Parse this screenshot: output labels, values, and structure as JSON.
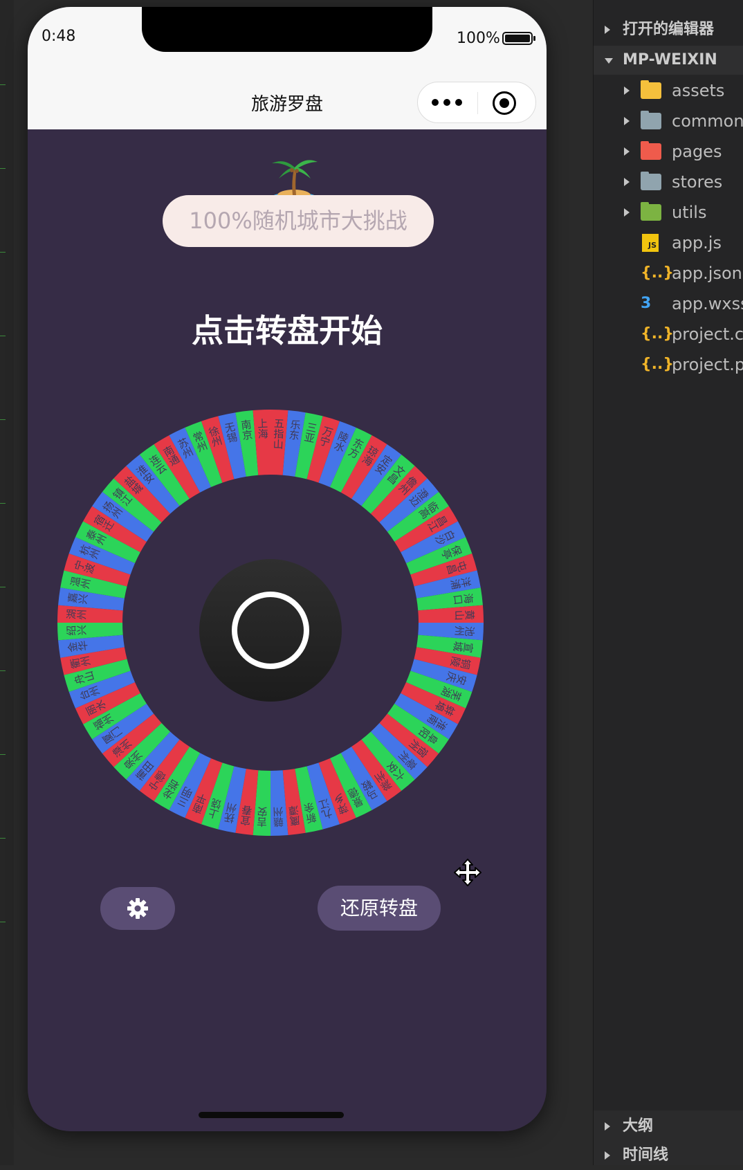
{
  "status_bar": {
    "time": "0:48",
    "battery": "100%"
  },
  "nav": {
    "title": "旅游罗盘"
  },
  "challenge_label": "100%随机城市大挑战",
  "headline": "点击转盘开始",
  "wheel": {
    "colors": [
      "#e63946",
      "#4575e8",
      "#2cd459"
    ],
    "city_texts": [
      "五指山",
      "乐东",
      "三亚",
      "万宁",
      "陵水",
      "东方",
      "琼海",
      "定安",
      "文昌",
      "儋州",
      "澄迈",
      "临高",
      "昌江",
      "白沙",
      "保亭",
      "屯昌",
      "洋浦",
      "海口",
      "黄山",
      "池州",
      "宣城",
      "铜陵",
      "安庆",
      "芜湖",
      "蚌埠",
      "淮南",
      "阜阳",
      "宿州",
      "亳州",
      "六安",
      "滁州",
      "马鞍",
      "景德",
      "萍乡",
      "九江",
      "新余",
      "鹰潭",
      "赣州",
      "吉安",
      "宜春",
      "抚州",
      "上饶",
      "南平",
      "三明",
      "龙岩",
      "宁德",
      "莆田",
      "泉州",
      "漳州",
      "厦门",
      "福州",
      "丽水",
      "台州",
      "舟山",
      "衢州",
      "金华",
      "绍兴",
      "湖州",
      "嘉兴",
      "温州",
      "宁波",
      "杭州",
      "泰州",
      "宿迁",
      "扬州",
      "镇江",
      "盐城",
      "淮安",
      "连云",
      "南通",
      "苏州",
      "常州",
      "徐州",
      "无锡",
      "南京",
      "上海"
    ]
  },
  "buttons": {
    "reset_label": "还原转盘"
  },
  "explorer": {
    "open_editors": "打开的编辑器",
    "project": "MP-WEIXIN",
    "items": [
      {
        "name": "assets"
      },
      {
        "name": "common"
      },
      {
        "name": "pages"
      },
      {
        "name": "stores"
      },
      {
        "name": "utils"
      },
      {
        "name": "app.js"
      },
      {
        "name": "app.json"
      },
      {
        "name": "app.wxss"
      },
      {
        "name": "project.c"
      },
      {
        "name": "project.p"
      }
    ],
    "outline": "大纲",
    "timeline": "时间线"
  },
  "icons": {
    "emoji": "palm-island-icon",
    "settings": "gear-icon",
    "move": "move-cursor-icon"
  }
}
